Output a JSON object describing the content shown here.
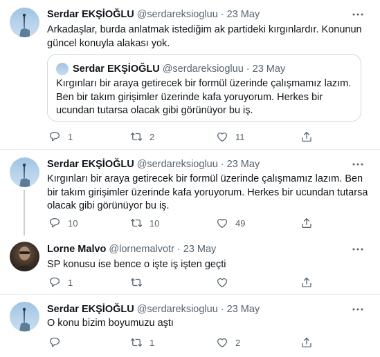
{
  "tweets": [
    {
      "name": "Serdar EKŞİOĞLU",
      "handle": "@serdareksiogluu",
      "separator": "·",
      "date": "23 May",
      "text": "Arkadaşlar, burda anlatmak istediğim ak partideki kırgınlardır. Konunun güncel konuyla alakası yok.",
      "quote": {
        "name": "Serdar EKŞİOĞLU",
        "handle": "@serdareksiogluu",
        "separator": "·",
        "date": "23 May",
        "text": "Kırgınları bir araya getirecek bir formül üzerinde çalışmamız lazım. Ben bir takım girişimler üzerinde kafa yoruyorum. Herkes bir ucundan tutarsa olacak gibi görünüyor bu iş."
      },
      "replies": "1",
      "retweets": "2",
      "likes": "11"
    },
    {
      "name": "Serdar EKŞİOĞLU",
      "handle": "@serdareksiogluu",
      "separator": "·",
      "date": "23 May",
      "text": "Kırgınları bir araya getirecek bir formül üzerinde çalışmamız lazım. Ben bir takım girişimler üzerinde kafa yoruyorum. Herkes bir ucundan tutarsa olacak gibi görünüyor bu iş.",
      "replies": "10",
      "retweets": "10",
      "likes": "49"
    },
    {
      "name": "Lorne Malvo",
      "handle": "@lornemalvotr",
      "separator": "·",
      "date": "23 May",
      "text": "SP konusu ise bence o işte iş işten geçti",
      "replies": "1",
      "retweets": "",
      "likes": ""
    },
    {
      "name": "Serdar EKŞİOĞLU",
      "handle": "@serdareksiogluu",
      "separator": "·",
      "date": "23 May",
      "text": "O konu bizim boyumuzu aştı",
      "replies": "",
      "retweets": "1",
      "likes": "2"
    }
  ],
  "icons": {
    "reply": "reply-icon",
    "retweet": "retweet-icon",
    "like": "heart-icon",
    "share": "share-icon",
    "more": "more-icon"
  },
  "colors": {
    "text": "#0f1419",
    "muted": "#536471",
    "border": "#cfd9de",
    "thread_line": "#c4cfd6"
  }
}
